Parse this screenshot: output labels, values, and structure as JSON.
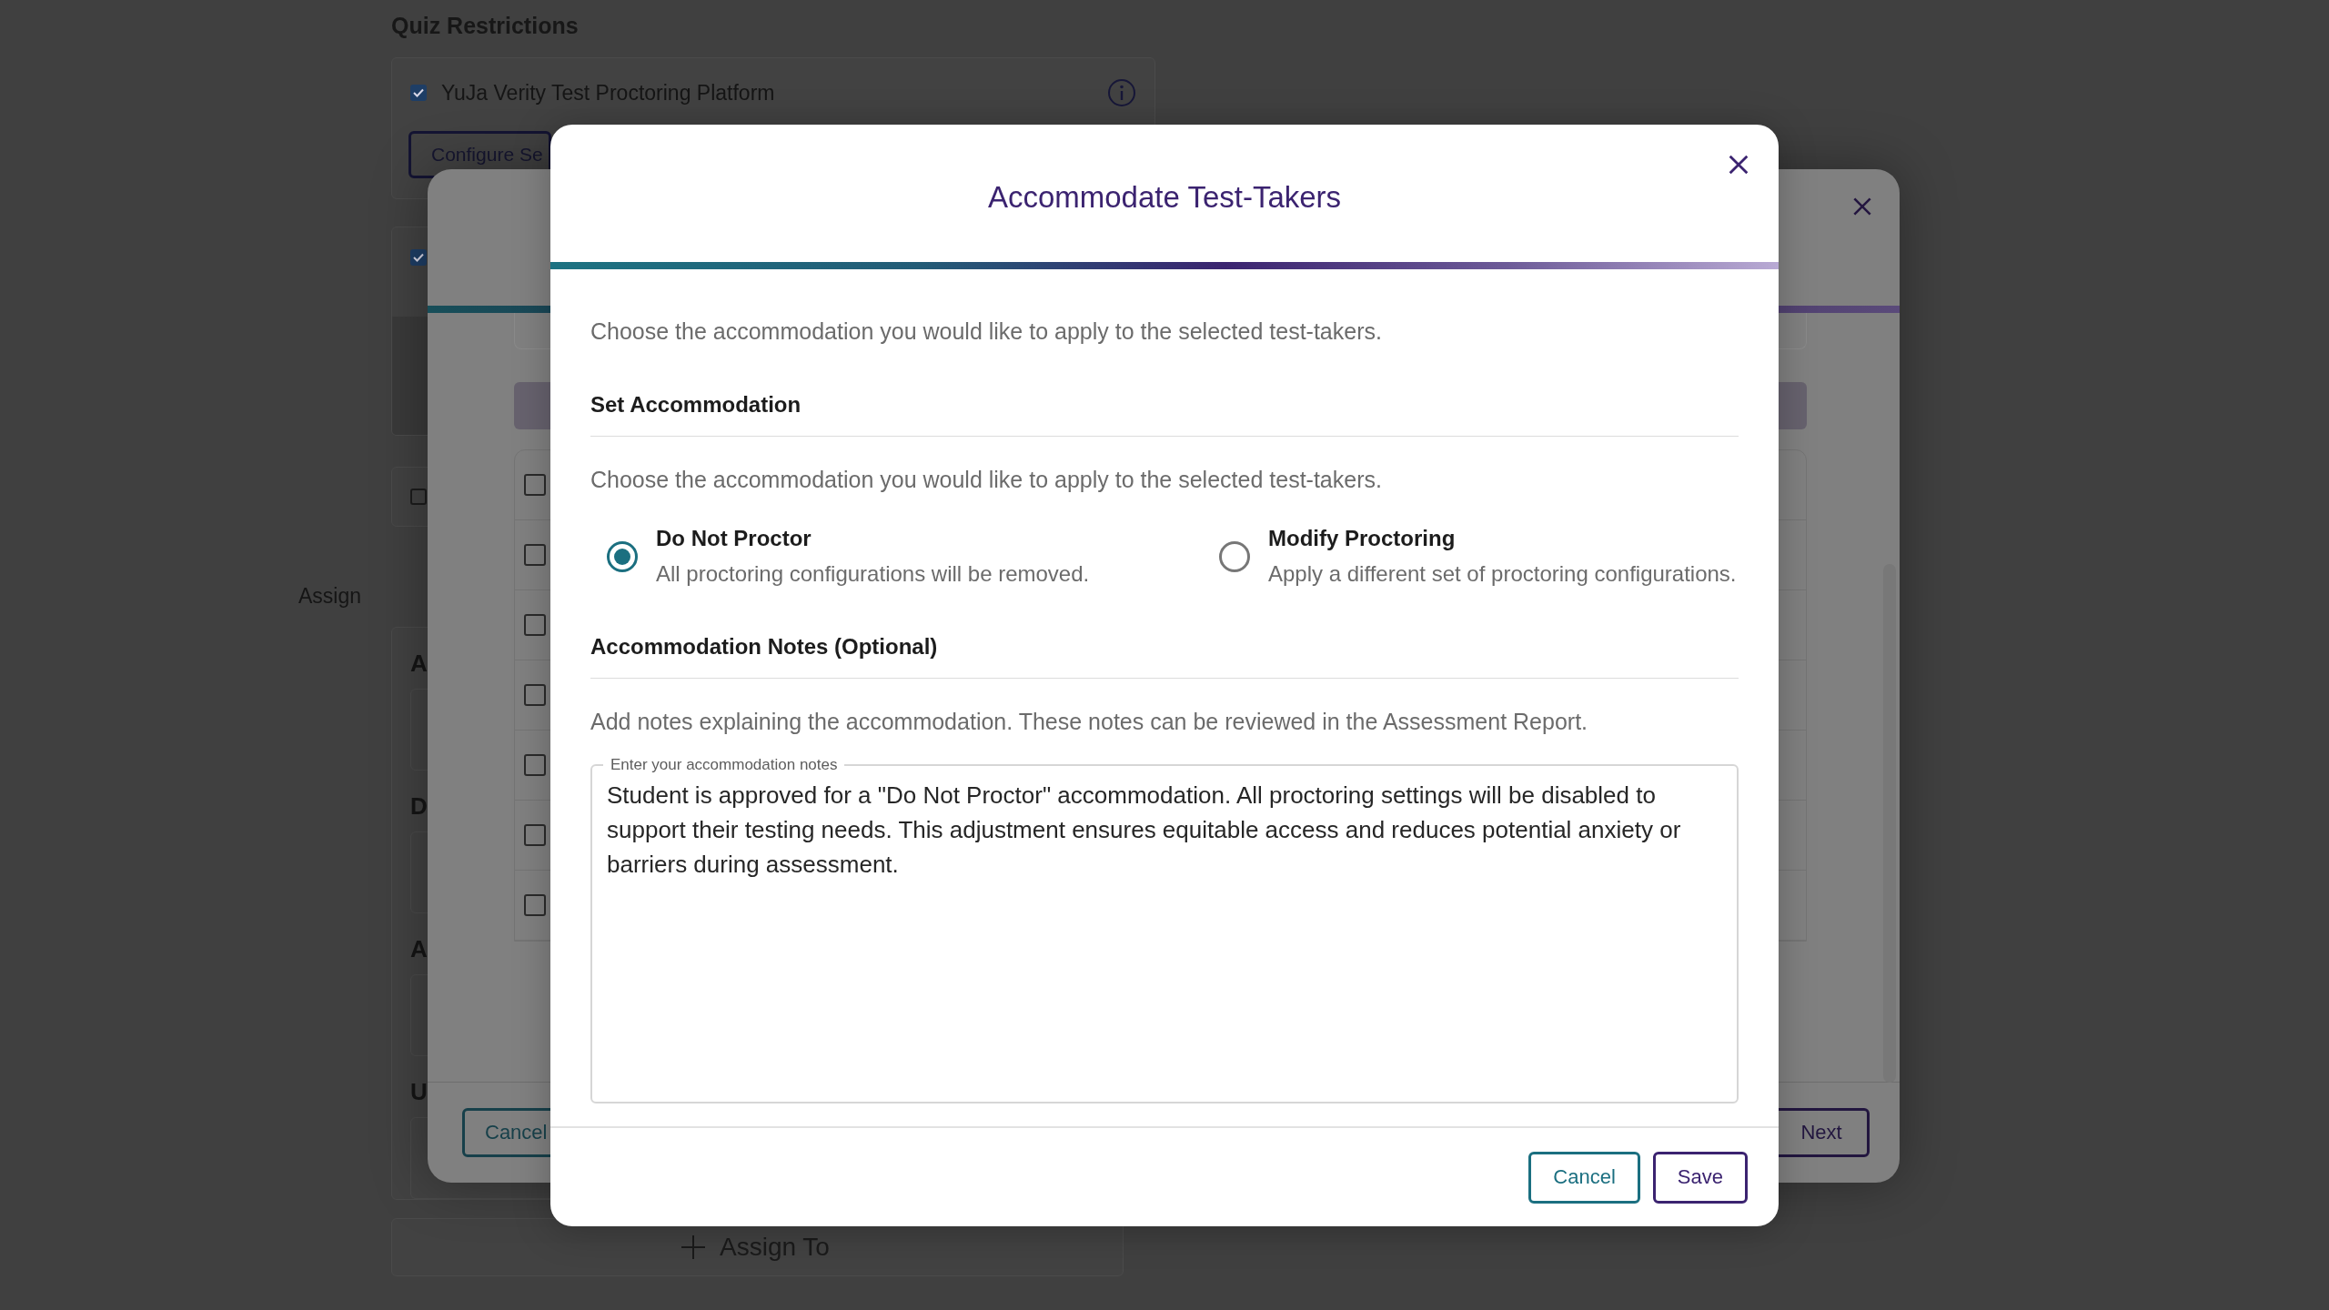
{
  "background_page": {
    "section_title": "Quiz Restrictions",
    "restrictions": [
      {
        "label": "YuJa Verity Test Proctoring Platform",
        "checked": true,
        "button": "Configure Se"
      },
      {
        "checked": true
      },
      {
        "checked": false
      }
    ],
    "assign_label": "Assign",
    "field_labels": [
      "A",
      "D",
      "A",
      "U"
    ],
    "assign_to_button": "Assign To"
  },
  "background_dialog": {
    "rows": [
      {
        "checked": false
      },
      {
        "checked": false
      },
      {
        "checked": false
      },
      {
        "checked": false
      },
      {
        "checked": false
      },
      {
        "checked": false
      },
      {
        "checked": false
      }
    ],
    "buttons": [
      {
        "label": "Cancel",
        "kind": "secondary"
      },
      {
        "label": "Next",
        "kind": "primary"
      }
    ]
  },
  "dialog": {
    "title": "Accommodate Test-Takers",
    "intro": "Choose the accommodation you would like to apply to the selected test-takers.",
    "set_accommodation": {
      "heading": "Set Accommodation",
      "description": "Choose the accommodation you would like to apply to the selected test-takers.",
      "options": [
        {
          "title": "Do Not Proctor",
          "description": "All proctoring configurations will be removed.",
          "selected": true
        },
        {
          "title": "Modify Proctoring",
          "description": "Apply a different set of proctoring configurations.",
          "selected": false
        }
      ]
    },
    "notes": {
      "heading": "Accommodation Notes (Optional)",
      "description": "Add notes explaining the accommodation. These notes can be reviewed in the Assessment Report.",
      "field": {
        "label": "Enter your accommodation notes",
        "value": "Student is approved for a \"Do Not Proctor\" accommodation. All proctoring settings will be disabled to support their testing needs. This adjustment ensures equitable access and reduces potential anxiety or barriers during assessment."
      }
    },
    "buttons": [
      {
        "label": "Cancel",
        "kind": "secondary"
      },
      {
        "label": "Save",
        "kind": "primary"
      }
    ]
  }
}
